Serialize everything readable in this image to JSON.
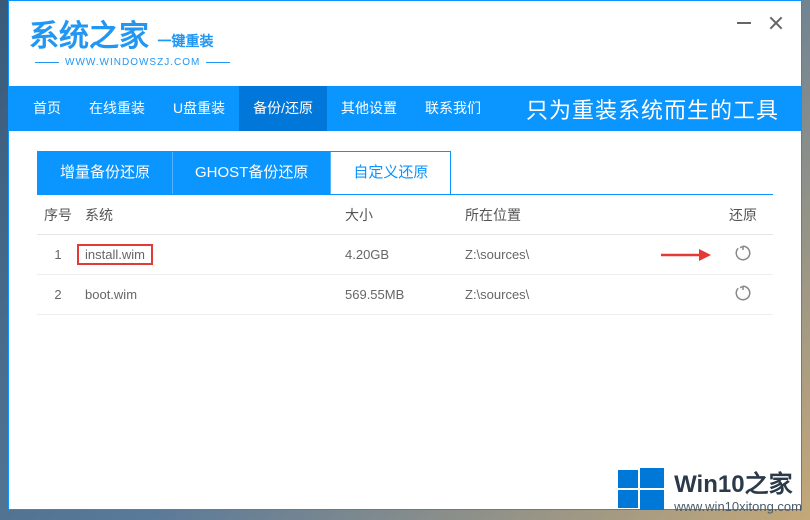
{
  "titlebar": {
    "brand": "系统之家",
    "brand_sub": "一键重装",
    "brand_url": "WWW.WINDOWSZJ.COM"
  },
  "nav": {
    "items": [
      "首页",
      "在线重装",
      "U盘重装",
      "备份/还原",
      "其他设置",
      "联系我们"
    ],
    "active_index": 3,
    "tagline": "只为重装系统而生的工具"
  },
  "subtabs": {
    "items": [
      "增量备份还原",
      "GHOST备份还原",
      "自定义还原"
    ],
    "active_index": 2
  },
  "table": {
    "headers": {
      "num": "序号",
      "sys": "系统",
      "size": "大小",
      "loc": "所在位置",
      "action": "还原"
    },
    "rows": [
      {
        "num": "1",
        "sys": "install.wim",
        "size": "4.20GB",
        "loc": "Z:\\sources\\",
        "highlight": true,
        "arrow": true
      },
      {
        "num": "2",
        "sys": "boot.wim",
        "size": "569.55MB",
        "loc": "Z:\\sources\\",
        "highlight": false,
        "arrow": false
      }
    ]
  },
  "watermark": {
    "title": "Win10之家",
    "url": "www.win10xitong.com"
  }
}
